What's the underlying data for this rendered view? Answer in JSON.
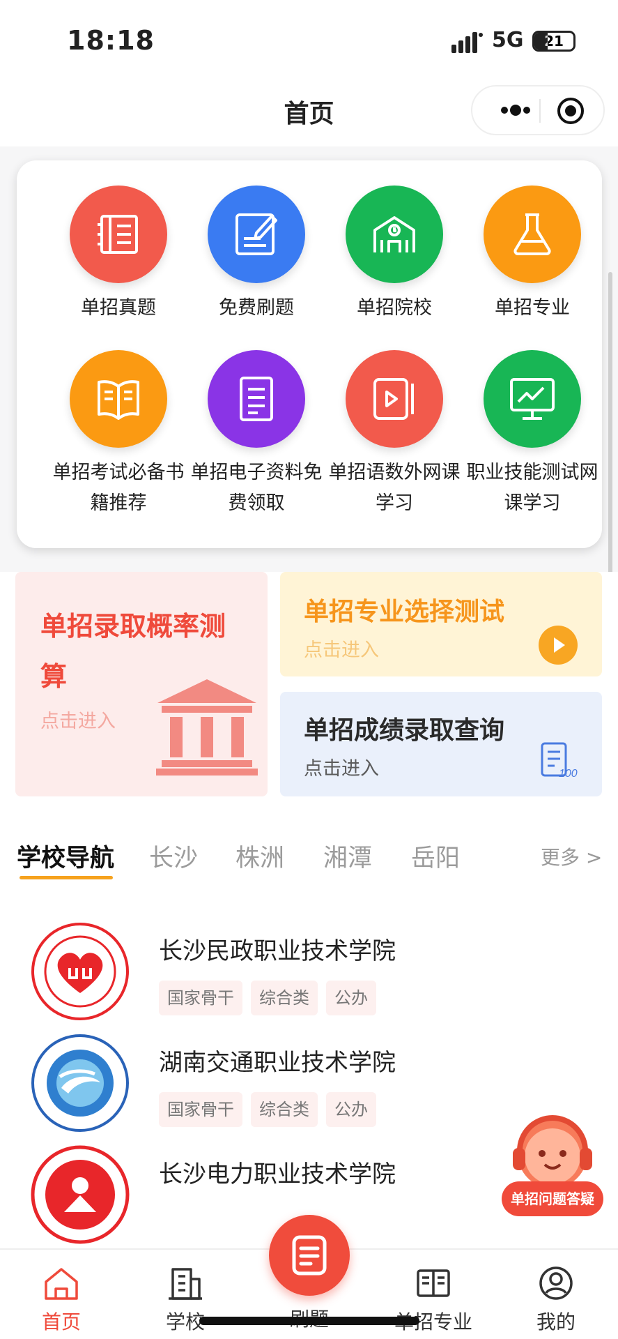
{
  "status_bar": {
    "time": "18:18",
    "network": "5G",
    "battery": "21"
  },
  "nav": {
    "title": "首页"
  },
  "grid": [
    {
      "label": "单招真题",
      "color": "#f25a4c",
      "icon": "book-stack-icon"
    },
    {
      "label": "免费刷题",
      "color": "#3a7bf2",
      "icon": "edit-note-icon"
    },
    {
      "label": "单招院校",
      "color": "#18b655",
      "icon": "school-building-icon"
    },
    {
      "label": "单招专业",
      "color": "#fb9a12",
      "icon": "flask-icon"
    },
    {
      "label": "单招考试必备书籍推荐",
      "color": "#fb9a12",
      "icon": "open-book-icon"
    },
    {
      "label": "单招电子资料免费领取",
      "color": "#8a34e6",
      "icon": "document-icon"
    },
    {
      "label": "单招语数外网课学习",
      "color": "#f25a4c",
      "icon": "video-icon"
    },
    {
      "label": "职业技能测试网课学习",
      "color": "#18b655",
      "icon": "monitor-chart-icon"
    }
  ],
  "promo": {
    "left": {
      "title": "单招录取概率测算",
      "subtitle": "点击进入"
    },
    "right_top": {
      "title": "单招专业选择测试",
      "subtitle": "点击进入"
    },
    "right_bottom": {
      "title": "单招成绩录取查询",
      "subtitle": "点击进入"
    }
  },
  "school_nav": {
    "tabs": [
      "学校导航",
      "长沙",
      "株洲",
      "湘潭",
      "岳阳"
    ],
    "more": "更多 >"
  },
  "schools": [
    {
      "name": "长沙民政职业技术学院",
      "tags": [
        "国家骨干",
        "综合类",
        "公办"
      ]
    },
    {
      "name": "湖南交通职业技术学院",
      "tags": [
        "国家骨干",
        "综合类",
        "公办"
      ]
    },
    {
      "name": "长沙电力职业技术学院",
      "tags": []
    }
  ],
  "assistant": {
    "label": "单招问题答疑"
  },
  "tabbar": [
    {
      "label": "首页",
      "icon": "home-icon"
    },
    {
      "label": "学校",
      "icon": "building-icon"
    },
    {
      "label": "刷题",
      "icon": "exercise-icon"
    },
    {
      "label": "单招专业",
      "icon": "open-book-icon"
    },
    {
      "label": "我的",
      "icon": "user-icon"
    }
  ],
  "colors": {
    "accent": "#ef4a3b",
    "tab_underline": "#f6a21e"
  }
}
